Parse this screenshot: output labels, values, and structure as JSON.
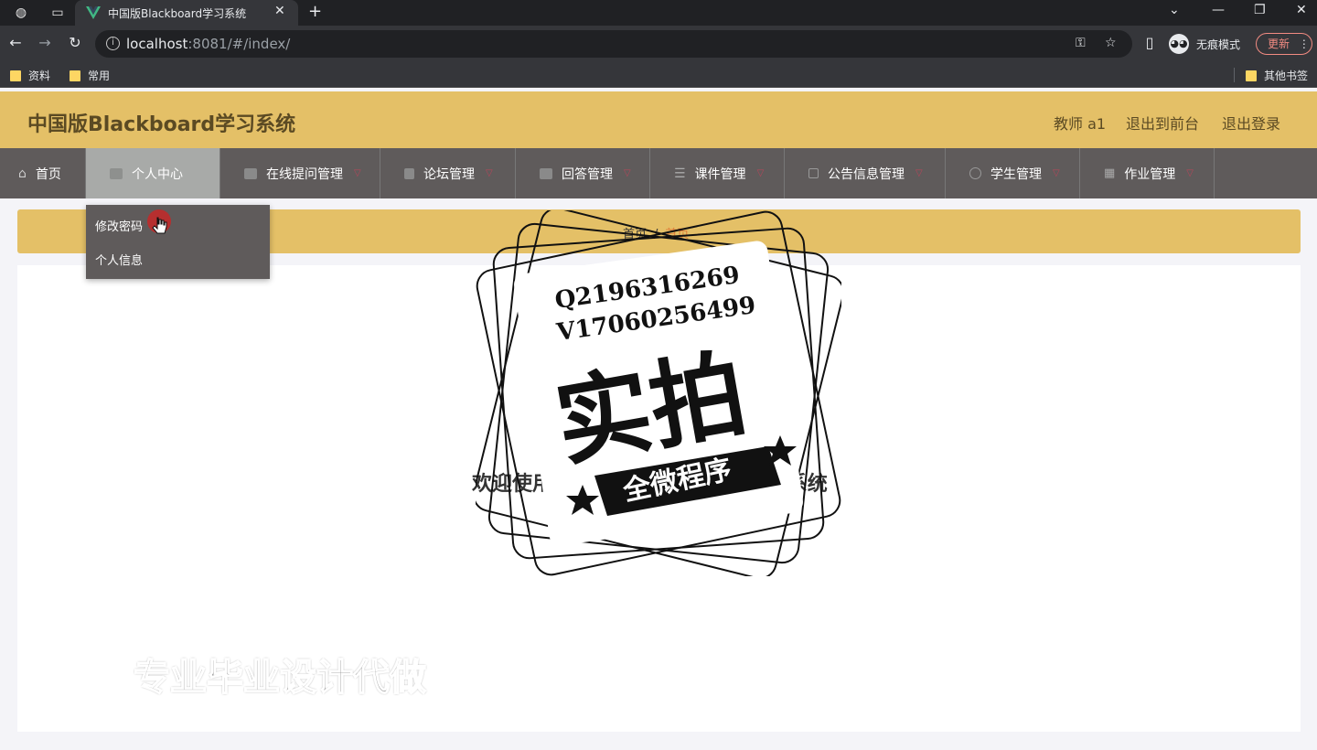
{
  "browser": {
    "tab_title": "中国版Blackboard学习系统",
    "url_host": "localhost",
    "url_rest": ":8081/#/index/",
    "incognito_label": "无痕模式",
    "update_label": "更新",
    "bookmarks": [
      "资料",
      "常用"
    ],
    "other_bookmarks": "其他书签"
  },
  "header": {
    "title": "中国版Blackboard学习系统",
    "user": "教师 a1",
    "back_front": "退出到前台",
    "logout": "退出登录"
  },
  "menu": {
    "items": [
      {
        "label": "首页"
      },
      {
        "label": "个人中心"
      },
      {
        "label": "在线提问管理"
      },
      {
        "label": "论坛管理"
      },
      {
        "label": "回答管理"
      },
      {
        "label": "课件管理"
      },
      {
        "label": "公告信息管理"
      },
      {
        "label": "学生管理"
      },
      {
        "label": "作业管理"
      }
    ]
  },
  "dropdown": {
    "items": [
      "修改密码",
      "个人信息"
    ]
  },
  "breadcrumb": {
    "home": "首页",
    "sep": "/",
    "current": "首页"
  },
  "welcome": "欢迎使用 中国版Blackboard学习系统",
  "watermark": {
    "qq": "Q2196316269",
    "wx": "V17060256499",
    "big": "实拍",
    "ribbon": "全微程序",
    "promo": "专业毕业设计代做"
  },
  "colors": {
    "accent": "#e4c067",
    "menu_bg": "#5f5b5b",
    "breadcrumb_current": "#e07b39"
  }
}
